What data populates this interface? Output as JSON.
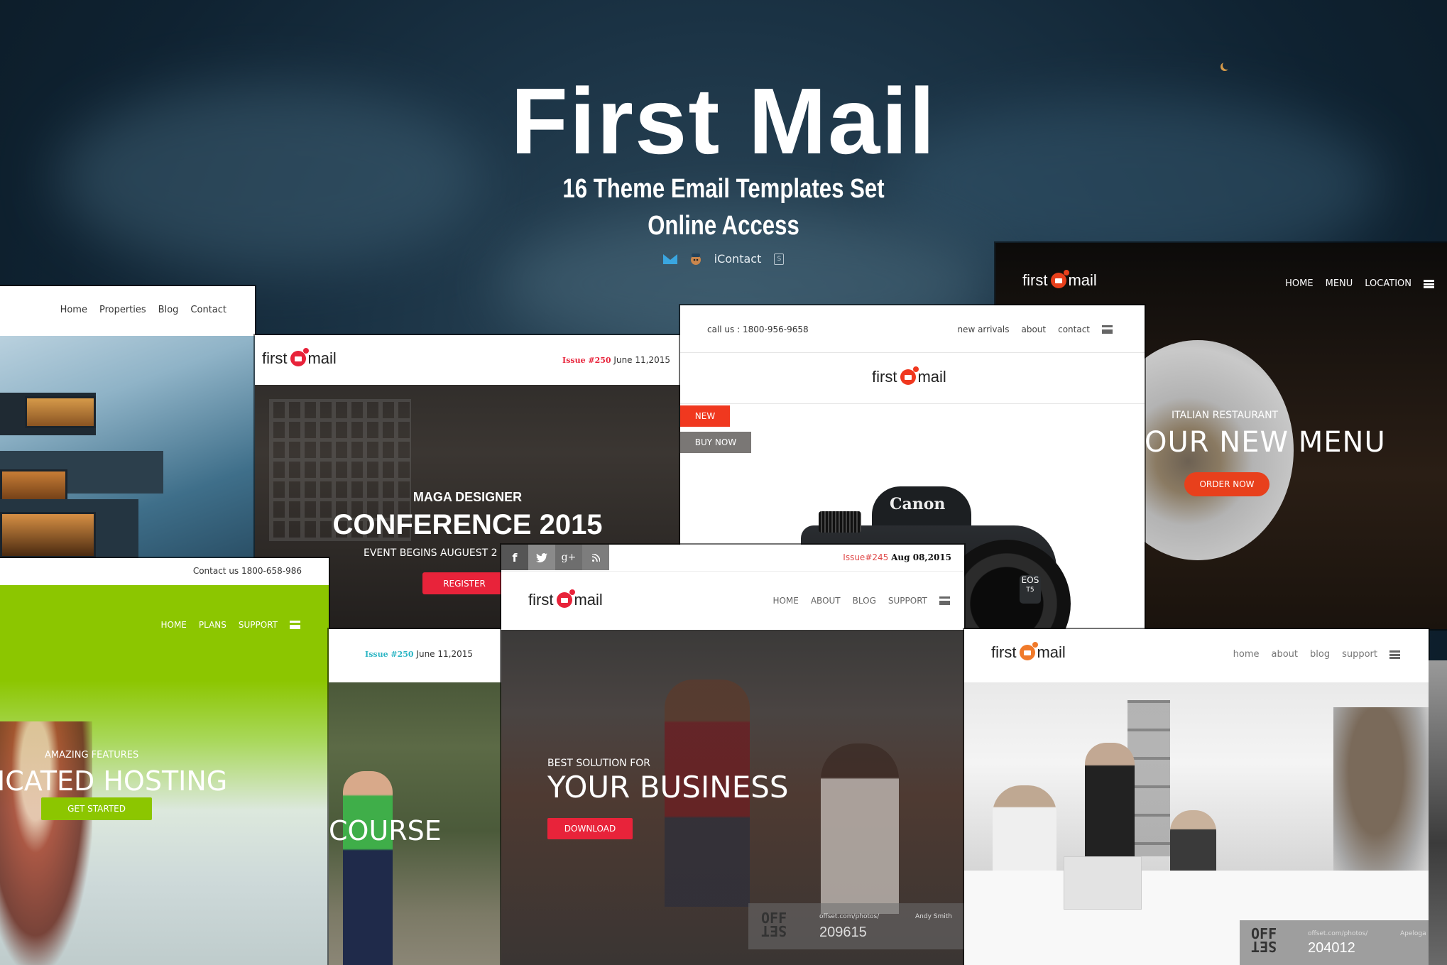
{
  "hero": {
    "title": "First Mail",
    "subtitle_line1": "16 Theme Email Templates Set",
    "subtitle_line2": "Online Access",
    "compat_icons": [
      "campaign-monitor-icon",
      "mailchimp-icon",
      "icontact-logo",
      "stampready-icon"
    ],
    "icontact_label": "iContact",
    "stampready_label": "S"
  },
  "brand": {
    "logo_first": "first",
    "logo_mail": "mail"
  },
  "templates": {
    "real_estate": {
      "nav": [
        "Home",
        "Properties",
        "Blog",
        "Contact"
      ]
    },
    "conference": {
      "issue_label": "Issue #250",
      "date": "June 11,2015",
      "kicker": "MAGA DESIGNER",
      "headline": "CONFERENCE 2015",
      "subline": "EVENT BEGINS AUGUEST 2",
      "cta": "REGISTER",
      "accent": "#e8233a"
    },
    "electronics": {
      "call_us": "call us : 1800-956-9658",
      "nav": [
        "new arrivals",
        "about",
        "contact"
      ],
      "badge_new": "NEW",
      "buy_now": "BUY NOW",
      "camera_brand": "Canon",
      "camera_model": "EOS",
      "camera_sub": "T5",
      "accent": "#f0381f"
    },
    "restaurant": {
      "nav": [
        "HOME",
        "MENU",
        "LOCATION"
      ],
      "kicker": "ITALIAN RESTAURANT",
      "headline": "OUR NEW MENU",
      "cta": "ORDER NOW",
      "accent": "#e8401c"
    },
    "hosting": {
      "contact": "Contact us 1800-658-986",
      "nav": [
        "HOME",
        "PLANS",
        "SUPPORT"
      ],
      "kicker": "AMAZING FEATURES",
      "headline": "ICATED HOSTING",
      "cta": "GET STARTED",
      "accent": "#8cc600"
    },
    "course": {
      "issue_label": "Issue #250",
      "date": "June 11,2015",
      "headline": "COURSE",
      "accent": "#2bb5c4"
    },
    "business": {
      "social": [
        "facebook-icon",
        "twitter-icon",
        "google-plus-icon",
        "rss-icon"
      ],
      "social_glyphs": [
        "f",
        "t",
        "g+",
        "rss"
      ],
      "issue_label": "Issue#245",
      "date": "Aug 08,2015",
      "nav": [
        "HOME",
        "ABOUT",
        "BLOG",
        "SUPPORT"
      ],
      "kicker": "BEST SOLUTION FOR",
      "headline": "YOUR BUSINESS",
      "cta": "DOWNLOAD",
      "credit_logo_top": "OFF",
      "credit_logo_bottom": "SET",
      "credit_url": "offset.com/photos/",
      "credit_number": "209615",
      "credit_author": "Andy Smith",
      "accent": "#e8233a"
    },
    "office": {
      "nav": [
        "home",
        "about",
        "blog",
        "support"
      ],
      "credit_logo_top": "OFF",
      "credit_logo_bottom": "SET",
      "credit_url": "offset.com/photos/",
      "credit_number": "204012",
      "credit_author": "Apeloga",
      "accent": "#f07a2a"
    }
  }
}
